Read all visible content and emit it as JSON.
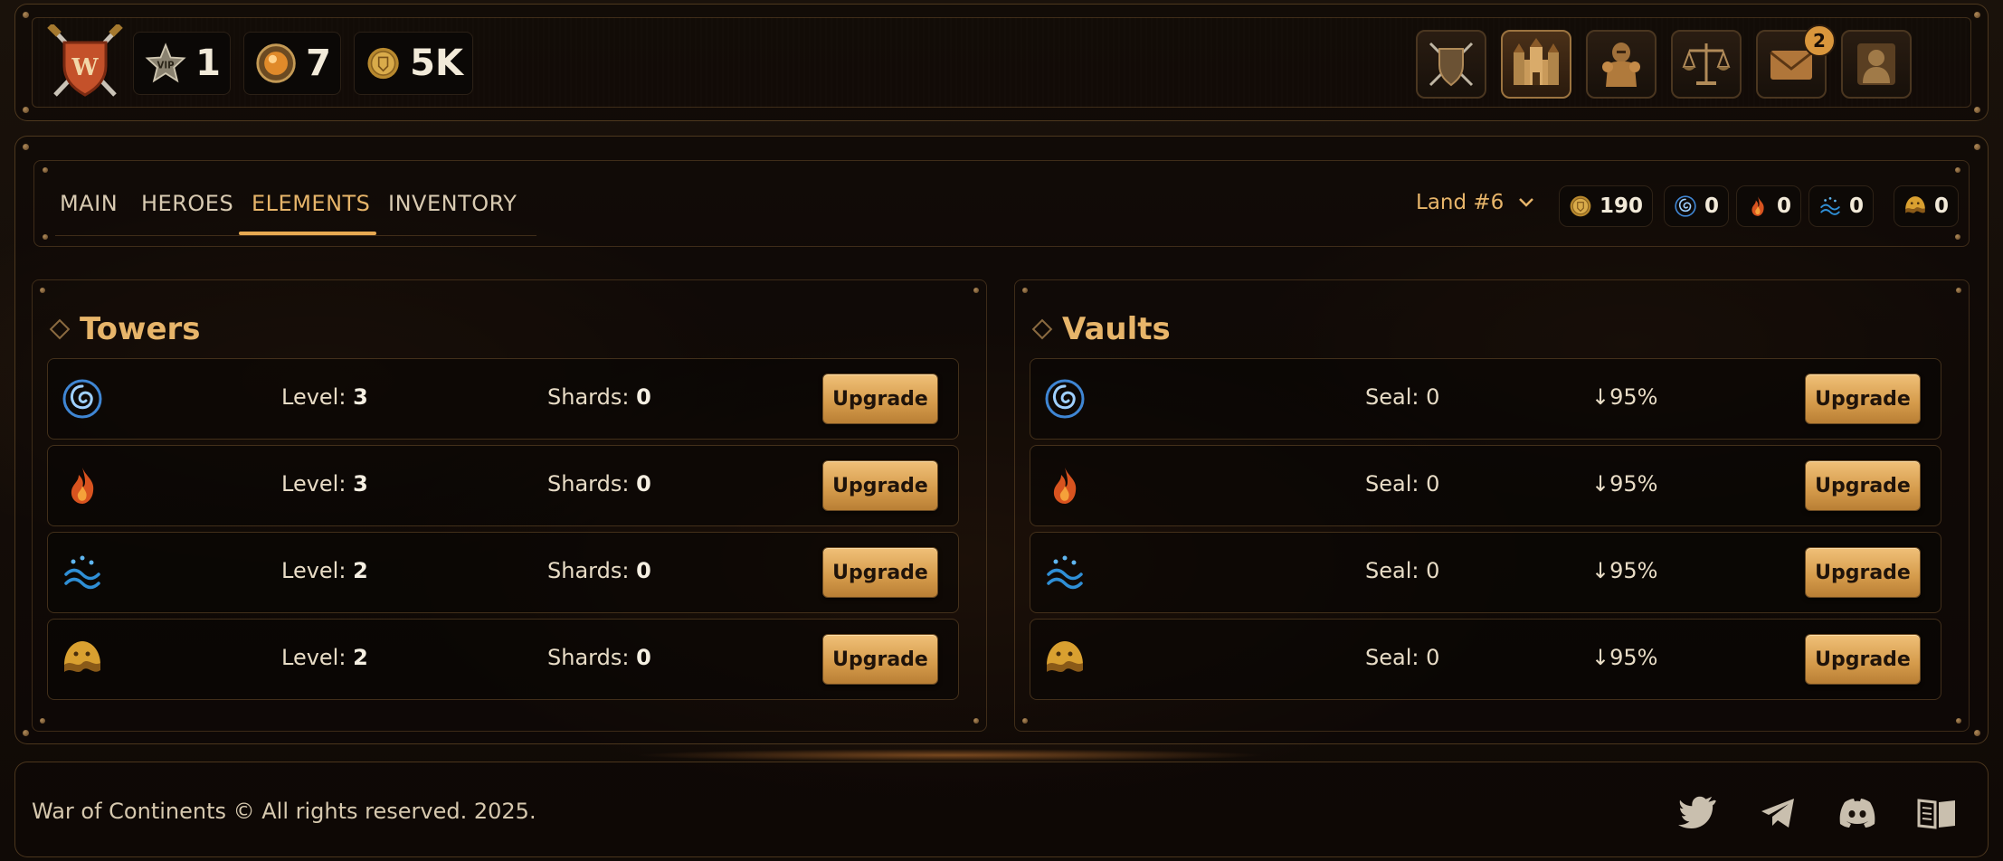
{
  "header": {
    "stats": [
      {
        "icon": "vip-star-icon",
        "value": "1"
      },
      {
        "icon": "orb-gem-icon",
        "value": "7"
      },
      {
        "icon": "gold-coin-icon",
        "value": "5K"
      }
    ],
    "nav": [
      {
        "icon": "shield-swords-icon",
        "active": false
      },
      {
        "icon": "castle-icon",
        "active": true
      },
      {
        "icon": "knight-armor-icon",
        "active": false
      },
      {
        "icon": "scales-icon",
        "active": false
      },
      {
        "icon": "mail-icon",
        "active": false,
        "badge": "2"
      },
      {
        "icon": "profile-silhouette-icon",
        "active": false
      }
    ]
  },
  "tabs": [
    {
      "label": "MAIN",
      "active": false
    },
    {
      "label": "HEROES",
      "active": false
    },
    {
      "label": "ELEMENTS",
      "active": true
    },
    {
      "label": "INVENTORY",
      "active": false
    }
  ],
  "land": {
    "label": "Land #6"
  },
  "resources": [
    {
      "icon": "gold-coin-icon",
      "value": "190"
    },
    {
      "icon": "air-swirl-icon",
      "value": "0"
    },
    {
      "icon": "fire-icon",
      "value": "0"
    },
    {
      "icon": "water-waves-icon",
      "value": "0"
    },
    {
      "icon": "earth-icon",
      "value": "0"
    }
  ],
  "towers": {
    "title": "Towers",
    "level_label": "Level:",
    "shards_label": "Shards:",
    "upgrade_label": "Upgrade",
    "rows": [
      {
        "icon": "air-swirl-icon",
        "level": "3",
        "shards": "0"
      },
      {
        "icon": "fire-icon",
        "level": "3",
        "shards": "0"
      },
      {
        "icon": "water-waves-icon",
        "level": "2",
        "shards": "0"
      },
      {
        "icon": "earth-icon",
        "level": "2",
        "shards": "0"
      }
    ]
  },
  "vaults": {
    "title": "Vaults",
    "seal_label": "Seal:",
    "upgrade_label": "Upgrade",
    "rows": [
      {
        "icon": "air-swirl-icon",
        "seal": "0",
        "rate": "↓95%"
      },
      {
        "icon": "fire-icon",
        "seal": "0",
        "rate": "↓95%"
      },
      {
        "icon": "water-waves-icon",
        "seal": "0",
        "rate": "↓95%"
      },
      {
        "icon": "earth-icon",
        "seal": "0",
        "rate": "↓95%"
      }
    ]
  },
  "footer": {
    "copyright": "War of Continents © All rights reserved. 2025.",
    "social": [
      "twitter-icon",
      "telegram-icon",
      "discord-icon",
      "book-icon"
    ]
  },
  "colors": {
    "accent": "#e7b56a",
    "button": "#d49a4a",
    "badge": "#d9963c",
    "air": "#4a8fd9",
    "fire": "#e0612a",
    "water": "#2f8fd6",
    "earth": "#d9a030"
  }
}
